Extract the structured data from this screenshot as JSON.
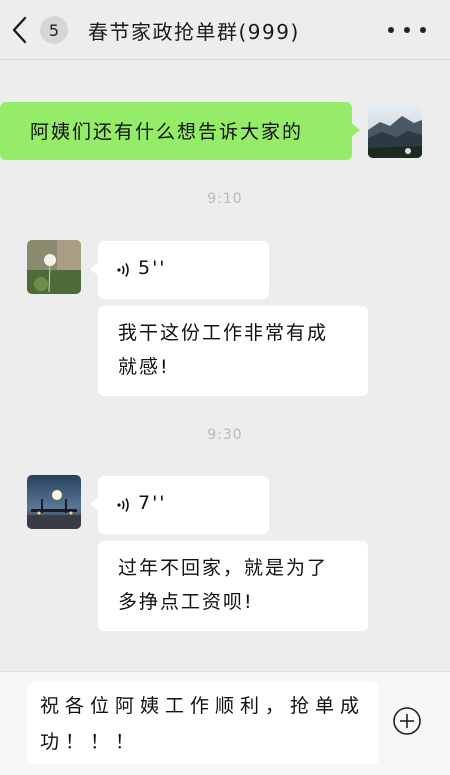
{
  "header": {
    "back_icon": "chevron-left-icon",
    "unread_count": "5",
    "title": "春节家政抢单群(999)",
    "more_icon": "more-dots-icon"
  },
  "messages": [
    {
      "side": "right",
      "type": "text",
      "text": "阿姨们还有什么想告诉大家的",
      "avatar": "mountain-landscape"
    },
    {
      "type": "time",
      "text": "9:10"
    },
    {
      "side": "left",
      "type": "voice",
      "duration": "5''",
      "avatar": "dandelion-photo"
    },
    {
      "side": "left",
      "type": "text",
      "lines": [
        "我干这份工作非常有成",
        "就感!"
      ]
    },
    {
      "type": "time",
      "text": "9:30"
    },
    {
      "side": "left",
      "type": "voice",
      "duration": "7''",
      "avatar": "night-bridge-photo"
    },
    {
      "side": "left",
      "type": "text",
      "lines": [
        "过年不回家，就是为了",
        "多挣点工资呗!"
      ]
    }
  ],
  "composer": {
    "value": "祝各位阿姨工作顺利，抢单成功！！！",
    "plus_icon": "plus-circle-icon"
  },
  "colors": {
    "background": "#ededed",
    "outgoing_bubble": "#95ec69",
    "incoming_bubble": "#ffffff",
    "timestamp": "#b8b8b8"
  }
}
